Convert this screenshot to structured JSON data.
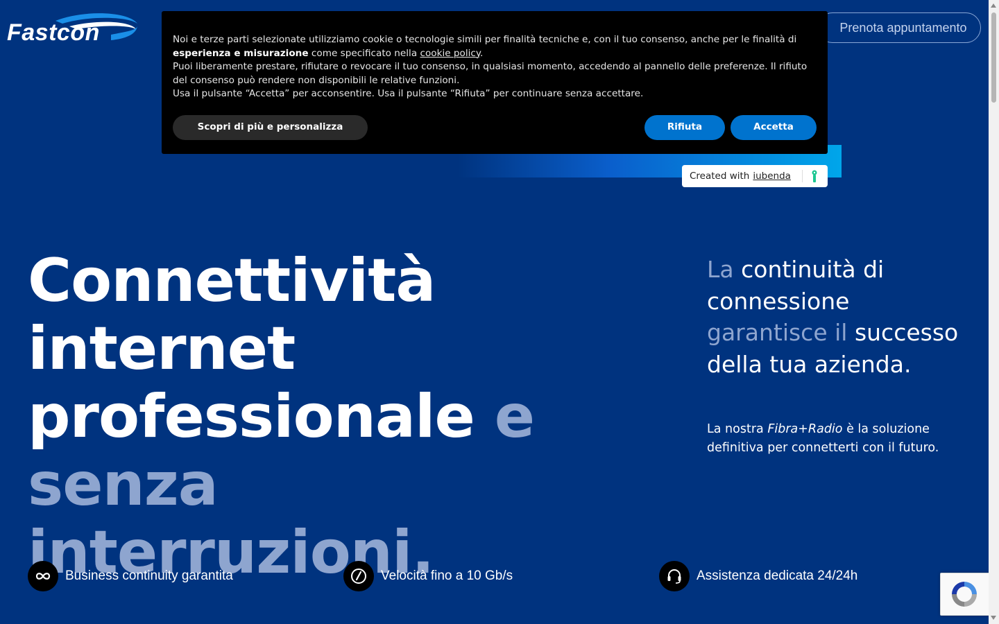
{
  "header": {
    "logo_text": "Fastcon",
    "cta_label": "Prenota appuntamento"
  },
  "cookie_banner": {
    "text_part1": "Noi e terze parti selezionate utilizziamo cookie o tecnologie simili per finalità tecniche e, con il tuo consenso, anche per le finalità di",
    "text_bold": "esperienza e misurazione",
    "text_part2": "come specificato nella",
    "link_label": "cookie policy",
    "text_part3": "Puoi liberamente prestare, rifiutare o revocare il tuo consenso, in qualsiasi momento, accedendo al pannello delle preferenze. Il rifiuto del consenso può rendere non disponibili le relative funzioni.",
    "text_part4": "Usa il pulsante “Accetta” per acconsentire. Usa il pulsante “Rifiuta” per continuare senza accettare.",
    "customize_label": "Scopri di più e personalizza",
    "reject_label": "Rifiuta",
    "accept_label": "Accetta",
    "credit_prefix": "Created with",
    "credit_link": "iubenda"
  },
  "hero": {
    "title_line1": "Connettività internet",
    "title_line2_white": "professionale",
    "title_line2_muted": "e senza",
    "title_line3": "interruzioni.",
    "side_muted1": "La",
    "side_white1": "continuità di connessione",
    "side_muted2": "garantisce il",
    "side_white2": "successo della tua azienda.",
    "sub_prefix": "La nostra",
    "sub_italic": "Fibra+Radio",
    "sub_suffix": "è la soluzione definitiva per connetterti con il futuro."
  },
  "features": [
    {
      "icon": "infinity-icon",
      "label": "Business continuity garantita"
    },
    {
      "icon": "speedometer-icon",
      "label": "Velocità fino a 10 Gb/s"
    },
    {
      "icon": "headset-icon",
      "label": "Assistenza dedicata 24/24h"
    }
  ],
  "colors": {
    "background": "#00337f",
    "muted_text": "#8ea5cf",
    "button_blue": "#0073ce",
    "banner": "#000000"
  }
}
